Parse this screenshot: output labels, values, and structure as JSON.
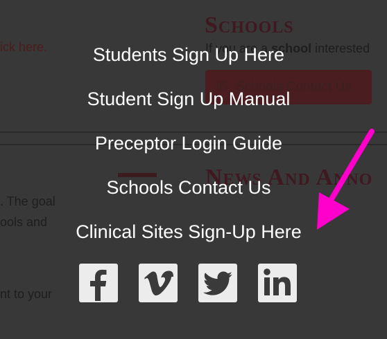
{
  "background": {
    "left_link_text": "ick here.",
    "schools_heading": "Schools",
    "schools_text_prefix": "If you are a ",
    "schools_text_bold": "school",
    "schools_text_suffix": " interested",
    "schools_button_label": "Schools Contact Us",
    "news_heading": "News And Anno",
    "para_line_1": ". The goal",
    "para_line_2": "ools and",
    "para_line_3": "nt to your"
  },
  "menu": {
    "items": [
      {
        "label": "Students Sign Up Here"
      },
      {
        "label": "Student Sign Up Manual"
      },
      {
        "label": "Preceptor Login Guide"
      },
      {
        "label": "Schools Contact Us"
      },
      {
        "label": "Clinical Sites Sign-Up Here"
      }
    ]
  },
  "social": {
    "icons": [
      "facebook-icon",
      "vimeo-icon",
      "twitter-icon",
      "linkedin-icon"
    ],
    "button_bg": "#ececec",
    "icon_color": "#3a3a3a"
  },
  "annotation": {
    "arrow_color": "#ff00cc"
  }
}
